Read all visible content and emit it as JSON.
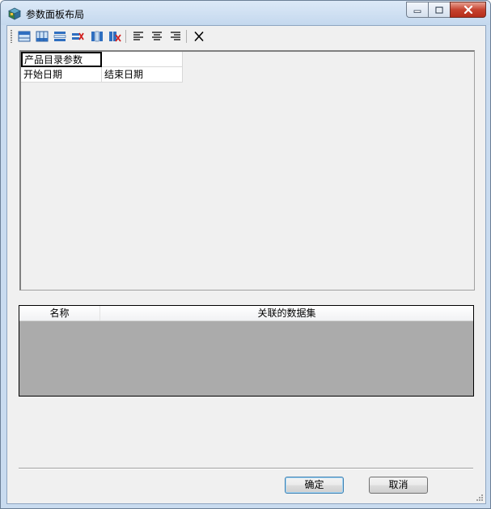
{
  "window": {
    "title": "参数面板布局"
  },
  "toolbar": {
    "buttons": [
      {
        "icon": "insert-row-above-icon"
      },
      {
        "icon": "insert-row-below-icon"
      },
      {
        "icon": "insert-column-icon"
      },
      {
        "icon": "delete-row-icon"
      },
      {
        "icon": "insert-column-left-icon"
      },
      {
        "icon": "delete-column-icon"
      },
      {
        "icon": "align-left-icon"
      },
      {
        "icon": "align-center-icon"
      },
      {
        "icon": "align-right-icon"
      },
      {
        "icon": "delete-icon"
      }
    ]
  },
  "layout": {
    "rows": [
      [
        "产品目录参数",
        ""
      ],
      [
        "开始日期",
        "结束日期"
      ]
    ]
  },
  "dataset_grid": {
    "columns": [
      "名称",
      "关联的数据集"
    ]
  },
  "footer": {
    "ok_label": "确定",
    "cancel_label": "取消"
  },
  "colors": {
    "title_bar": "#c4d8ee",
    "client_background": "#f0f0f0",
    "grid_empty_area": "#ababab",
    "close_button": "#c6432f"
  }
}
